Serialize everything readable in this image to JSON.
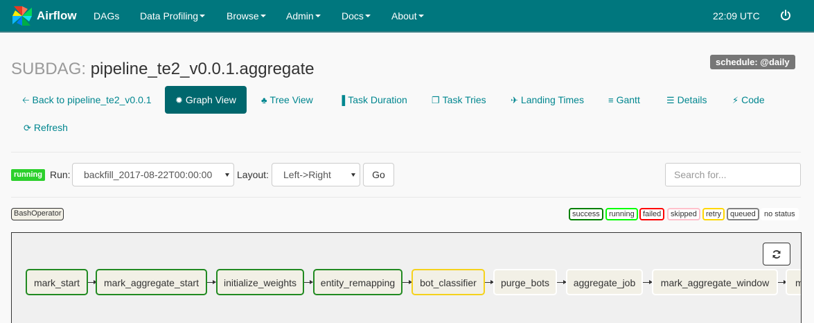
{
  "nav": {
    "brand": "Airflow",
    "items": [
      {
        "label": "DAGs",
        "caret": false
      },
      {
        "label": "Data Profiling",
        "caret": true
      },
      {
        "label": "Browse",
        "caret": true
      },
      {
        "label": "Admin",
        "caret": true
      },
      {
        "label": "Docs",
        "caret": true
      },
      {
        "label": "About",
        "caret": true
      }
    ],
    "time": "22:09 UTC"
  },
  "header": {
    "prefix": "SUBDAG:",
    "dag_id": "pipeline_te2_v0.0.1.aggregate",
    "schedule": "schedule: @daily"
  },
  "tabs": [
    {
      "label": "Back to pipeline_te2_v0.0.1",
      "icon": "arrow-left-icon",
      "active": false
    },
    {
      "label": "Graph View",
      "icon": "certificate-icon",
      "active": true
    },
    {
      "label": "Tree View",
      "icon": "tree-icon",
      "active": false
    },
    {
      "label": "Task Duration",
      "icon": "bar-chart-icon",
      "active": false
    },
    {
      "label": "Task Tries",
      "icon": "files-icon",
      "active": false
    },
    {
      "label": "Landing Times",
      "icon": "plane-icon",
      "active": false
    },
    {
      "label": "Gantt",
      "icon": "align-left-icon",
      "active": false
    },
    {
      "label": "Details",
      "icon": "list-icon",
      "active": false
    },
    {
      "label": "Code",
      "icon": "flash-icon",
      "active": false
    },
    {
      "label": "Refresh",
      "icon": "refresh-icon",
      "active": false
    }
  ],
  "controls": {
    "state_badge": "running",
    "run_label": "Run:",
    "run_value": "backfill_2017-08-22T00:00:00",
    "layout_label": "Layout:",
    "layout_value": "Left->Right",
    "go_label": "Go",
    "search_placeholder": "Search for..."
  },
  "operator_legend": "BashOperator",
  "state_legend": [
    {
      "label": "success",
      "color": "#008000"
    },
    {
      "label": "running",
      "color": "#00ff00"
    },
    {
      "label": "failed",
      "color": "#ff0000"
    },
    {
      "label": "skipped",
      "color": "#ffc0cb"
    },
    {
      "label": "retry",
      "color": "#ffd700"
    },
    {
      "label": "queued",
      "color": "#808080"
    },
    {
      "label": "no status",
      "color": "#ffffff"
    }
  ],
  "graph": {
    "nodes": [
      {
        "label": "mark_start",
        "state": "success"
      },
      {
        "label": "mark_aggregate_start",
        "state": "success"
      },
      {
        "label": "initialize_weights",
        "state": "success"
      },
      {
        "label": "entity_remapping",
        "state": "success"
      },
      {
        "label": "bot_classifier",
        "state": "retry"
      },
      {
        "label": "purge_bots",
        "state": "no status"
      },
      {
        "label": "aggregate_job",
        "state": "no status"
      },
      {
        "label": "mark_aggregate_window",
        "state": "no status"
      },
      {
        "label": "m",
        "state": "no status"
      }
    ]
  }
}
